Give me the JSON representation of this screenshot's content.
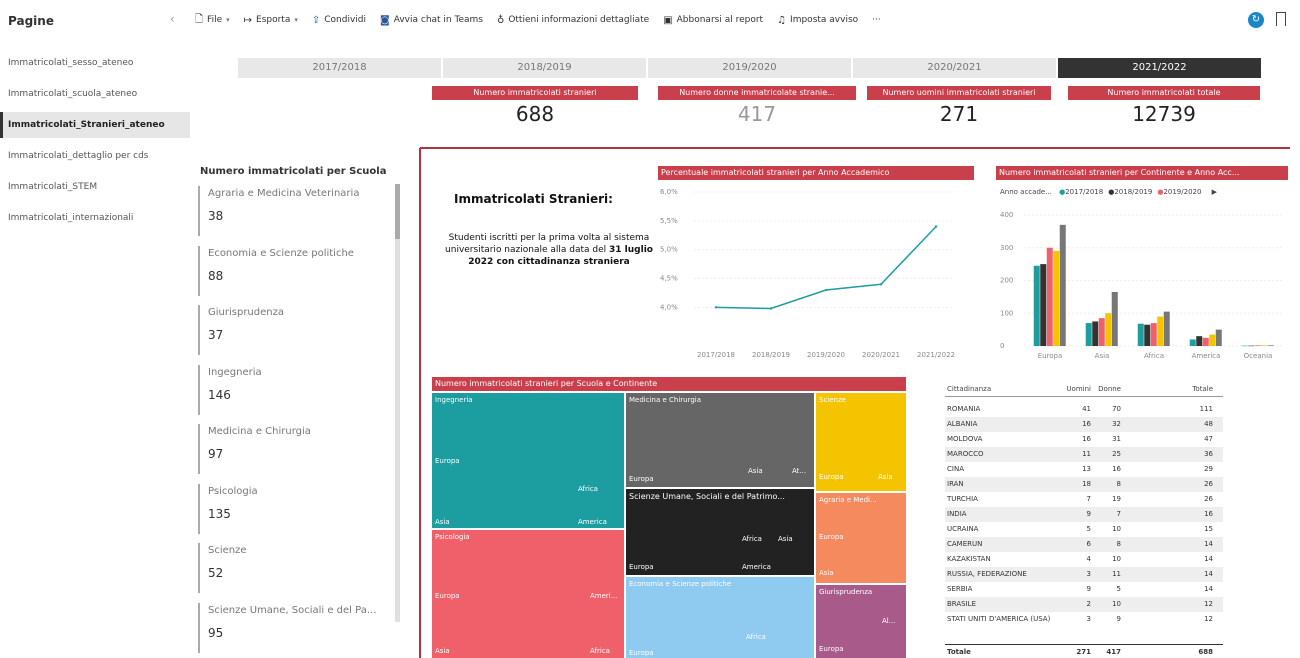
{
  "pages_pane": {
    "title": "Pagine",
    "collapse_icon": "chevron-left",
    "items": [
      {
        "label": "Immatricolati_sesso_ateneo",
        "active": false
      },
      {
        "label": "Immatricolati_scuola_ateneo",
        "active": false
      },
      {
        "label": "Immatricolati_Stranieri_ateneo",
        "active": true
      },
      {
        "label": "Immatricolati_dettaglio per cds",
        "active": false
      },
      {
        "label": "Immatricolati_STEM",
        "active": false
      },
      {
        "label": "Immatricolati_internazionali",
        "active": false
      }
    ]
  },
  "toolbar": {
    "file": "File",
    "export": "Esporta",
    "share": "Condividi",
    "teams": "Avvia chat in Teams",
    "insights": "Ottieni informazioni dettagliate",
    "subscribe": "Abbonarsi al report",
    "alert": "Imposta avviso",
    "more": "···"
  },
  "years": [
    {
      "label": "2017/2018",
      "selected": false
    },
    {
      "label": "2018/2019",
      "selected": false
    },
    {
      "label": "2019/2020",
      "selected": false
    },
    {
      "label": "2020/2021",
      "selected": false
    },
    {
      "label": "2021/2022",
      "selected": true
    }
  ],
  "kpis": [
    {
      "label": "Numero immatricolati stranieri",
      "value": "688"
    },
    {
      "label": "Numero donne immatricolate stranie...",
      "value": "417"
    },
    {
      "label": "Numero uomini immatricolati stranieri",
      "value": "271"
    },
    {
      "label": "Numero immatricolati totale",
      "value": "12739"
    }
  ],
  "scuola": {
    "title": "Numero immatricolati per Scuola",
    "items": [
      {
        "name": "Agraria e Medicina Veterinaria",
        "value": "38"
      },
      {
        "name": "Economia e Scienze politiche",
        "value": "88"
      },
      {
        "name": "Giurisprudenza",
        "value": "37"
      },
      {
        "name": "Ingegneria",
        "value": "146"
      },
      {
        "name": "Medicina e Chirurgia",
        "value": "97"
      },
      {
        "name": "Psicologia",
        "value": "135"
      },
      {
        "name": "Scienze",
        "value": "52"
      },
      {
        "name": "Scienze Umane, Sociali e del Pa...",
        "value": "95"
      }
    ]
  },
  "textbox": {
    "title": "Immatricolati Stranieri:",
    "body_plain": "Studenti iscritti per la prima volta al sistema universitario nazionale alla data del ",
    "body_bold": "31 luglio 2022",
    "body_bold2": " con cittadinanza straniera"
  },
  "line_chart": {
    "title": "Percentuale immatricolati stranieri per Anno Accademico"
  },
  "bar_chart": {
    "title": "Numero immatricolati stranieri per Continente e Anno Acc...",
    "legend_title": "Anno accade...",
    "legend_more": "▶"
  },
  "treemap": {
    "title": "Numero immatricolati stranieri per Scuola e Continente",
    "labels": {
      "ingegneria": "Ingegneria",
      "medicina": "Medicina e Chirurgia",
      "scienze": "Scienze",
      "psicologia": "Psicologia",
      "scienze_umane": "Scienze Umane, Sociali e del Patrimo...",
      "agraria": "Agraria e Medi...",
      "economia": "Economia e Scienze politiche",
      "giurisprudenza": "Giurisprudenza",
      "europa": "Europa",
      "asia": "Asia",
      "africa": "Africa",
      "america": "America",
      "ameri": "Ameri...",
      "at": "At...",
      "at2": "Al...",
      "africa_short": "Afric"
    }
  },
  "table": {
    "headers": [
      "Cittadinanza",
      "Uomini",
      "Donne",
      "Totale"
    ],
    "rows": [
      [
        "ROMANIA",
        "41",
        "70",
        "111"
      ],
      [
        "ALBANIA",
        "16",
        "32",
        "48"
      ],
      [
        "MOLDOVA",
        "16",
        "31",
        "47"
      ],
      [
        "MAROCCO",
        "11",
        "25",
        "36"
      ],
      [
        "CINA",
        "13",
        "16",
        "29"
      ],
      [
        "IRAN",
        "18",
        "8",
        "26"
      ],
      [
        "TURCHIA",
        "7",
        "19",
        "26"
      ],
      [
        "INDIA",
        "9",
        "7",
        "16"
      ],
      [
        "UCRAINA",
        "5",
        "10",
        "15"
      ],
      [
        "CAMERUN",
        "6",
        "8",
        "14"
      ],
      [
        "KAZAKISTAN",
        "4",
        "10",
        "14"
      ],
      [
        "RUSSIA, FEDERAZIONE",
        "3",
        "11",
        "14"
      ],
      [
        "SERBIA",
        "9",
        "5",
        "14"
      ],
      [
        "BRASILE",
        "2",
        "10",
        "12"
      ],
      [
        "STATI UNITI D'AMERICA (USA)",
        "3",
        "9",
        "12"
      ]
    ],
    "total": [
      "Totale",
      "271",
      "417",
      "688"
    ]
  },
  "colors": {
    "accent_red": "#c9404c",
    "teal": "#1c9ea0",
    "dark": "#333333",
    "pink": "#f0606a",
    "yellow": "#f5c400",
    "gray": "#777777"
  },
  "chart_data": [
    {
      "type": "line",
      "title": "Percentuale immatricolati stranieri per Anno Accademico",
      "categories": [
        "2017/2018",
        "2018/2019",
        "2019/2020",
        "2020/2021",
        "2021/2022"
      ],
      "values": [
        4.0,
        3.98,
        4.3,
        4.4,
        5.4
      ],
      "ytick_labels": [
        "4,0%",
        "4,5%",
        "5,0%",
        "5,5%",
        "6,0%"
      ],
      "ylim": [
        3.85,
        6.0
      ]
    },
    {
      "type": "bar",
      "title": "Numero immatricolati stranieri per Continente e Anno Acc...",
      "categories": [
        "Europa",
        "Asia",
        "Africa",
        "America",
        "Oceania"
      ],
      "series": [
        {
          "name": "2017/2018",
          "color": "#1c9ea0",
          "values": [
            245,
            70,
            68,
            20,
            1
          ]
        },
        {
          "name": "2018/2019",
          "color": "#333333",
          "values": [
            250,
            75,
            65,
            30,
            1
          ]
        },
        {
          "name": "2019/2020",
          "color": "#f0606a",
          "values": [
            300,
            85,
            70,
            25,
            2
          ]
        },
        {
          "name": "2020/2021",
          "color": "#f5c400",
          "values": [
            290,
            100,
            90,
            35,
            2
          ]
        },
        {
          "name": "2021/2022",
          "color": "#777777",
          "values": [
            370,
            165,
            105,
            50,
            2
          ]
        }
      ],
      "legend_visible": [
        "2017/2018",
        "2018/2019",
        "2019/2020"
      ],
      "ytick_labels": [
        "0",
        "100",
        "200",
        "300",
        "400"
      ],
      "ylim": [
        0,
        400
      ]
    }
  ]
}
